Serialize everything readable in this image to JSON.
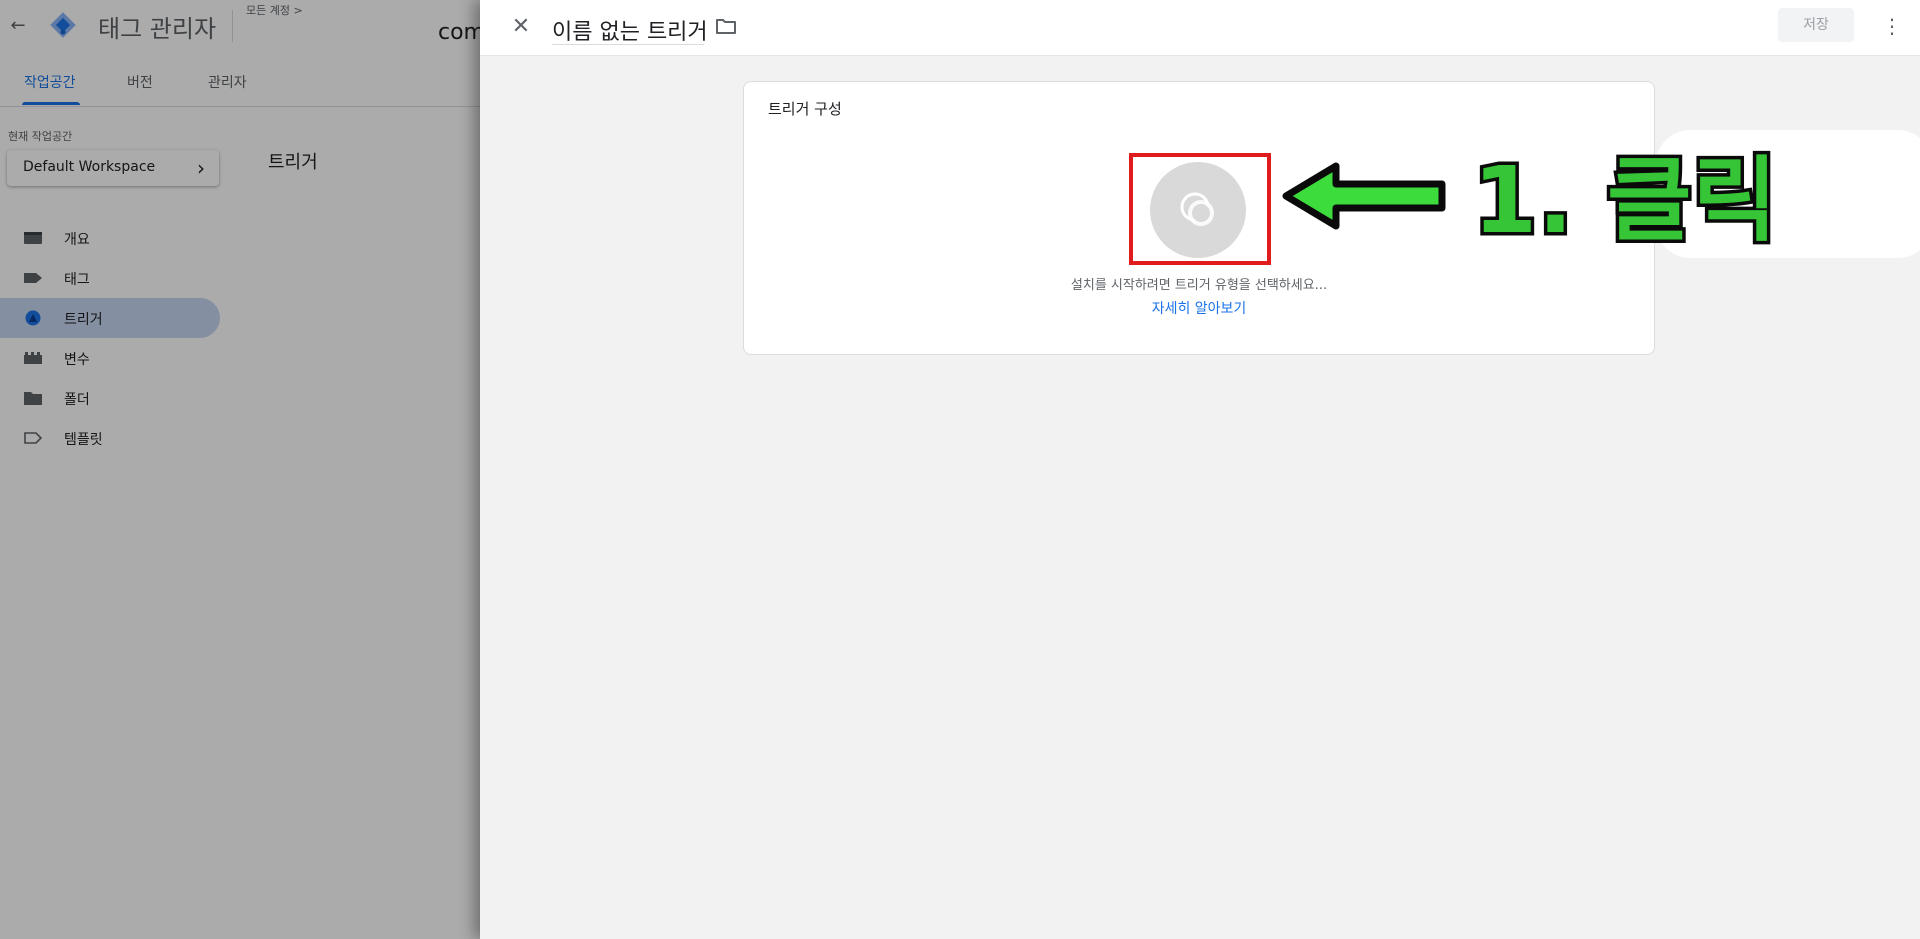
{
  "app": {
    "title": "태그 관리자",
    "breadcrumb": "모든 계정 >",
    "container_name": "com"
  },
  "tabs": [
    {
      "label": "작업공간",
      "active": true
    },
    {
      "label": "버전",
      "active": false
    },
    {
      "label": "관리자",
      "active": false
    }
  ],
  "workspace": {
    "label": "현재 작업공간",
    "name": "Default Workspace"
  },
  "sidebar": {
    "items": [
      {
        "label": "개요",
        "icon": "overview-icon",
        "active": false
      },
      {
        "label": "태그",
        "icon": "tag-icon",
        "active": false
      },
      {
        "label": "트리거",
        "icon": "trigger-icon",
        "active": true
      },
      {
        "label": "변수",
        "icon": "variables-icon",
        "active": false
      },
      {
        "label": "폴더",
        "icon": "folder-icon",
        "active": false
      },
      {
        "label": "템플릿",
        "icon": "template-icon",
        "active": false
      }
    ]
  },
  "content": {
    "title": "트리거"
  },
  "panel": {
    "trigger_name": "이름 없는 트리거",
    "save_label": "저장",
    "config": {
      "title": "트리거 구성",
      "hint": "설치를 시작하려면 트리거 유형을 선택하세요...",
      "learn_more": "자세히 알아보기"
    }
  },
  "annotation": {
    "text": "1. 클릭",
    "box_color": "#e01b1b",
    "arrow_color": "#3ddc3d"
  },
  "colors": {
    "accent": "#1a73e8",
    "nav_active_bg": "#c6d6f2",
    "panel_bg": "#f2f2f2"
  }
}
